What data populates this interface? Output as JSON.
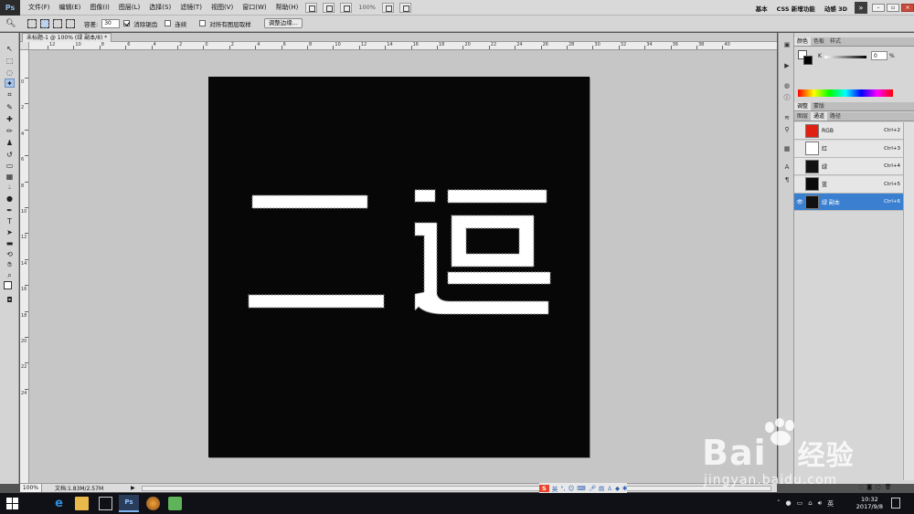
{
  "app": {
    "logo": "Ps",
    "menus": [
      "文件(F)",
      "编辑(E)",
      "图像(I)",
      "图层(L)",
      "选择(S)",
      "滤镜(T)",
      "视图(V)",
      "窗口(W)",
      "帮助(H)"
    ],
    "zoom_value": "100%",
    "workspaces": [
      "基本",
      "CSS 新增功能",
      "动感 3D"
    ],
    "more": "»"
  },
  "options": {
    "tolerance_label": "容差:",
    "tolerance_value": "30",
    "antialias_label": "消除锯齿",
    "contiguous_label": "连续",
    "all_layers_label": "对所有图层取样",
    "refine_edge_label": "调整边缘..."
  },
  "document": {
    "tab_title": "未标题-1 @ 100% (绿 副本/8) *",
    "zoom": "100%",
    "doc_info": "文档:1.83M/2.57M",
    "ruler_h": [
      "12",
      "10",
      "8",
      "6",
      "4",
      "2",
      "0",
      "2",
      "4",
      "6",
      "8",
      "10",
      "12",
      "14",
      "16",
      "18",
      "20",
      "22",
      "24",
      "26",
      "28",
      "30",
      "32",
      "34",
      "36",
      "38",
      "40"
    ],
    "ruler_v": [
      "0",
      "2",
      "4",
      "6",
      "8",
      "10",
      "12",
      "14",
      "16",
      "18",
      "20",
      "22",
      "24"
    ],
    "canvas_text": "二逗"
  },
  "panels": {
    "top_tabs": [
      "颜色",
      "色板",
      "样式"
    ],
    "k_label": "K",
    "k_value": "0",
    "percent": "%",
    "mid_tabs": [
      "调整",
      "蒙版"
    ],
    "bottom_tabs": [
      "图层",
      "通道",
      "路径"
    ],
    "channels": [
      {
        "name": "RGB",
        "shortcut": "Ctrl+2",
        "thumb": "#e02010",
        "selected": false,
        "eye": ""
      },
      {
        "name": "红",
        "shortcut": "Ctrl+3",
        "thumb": "#ffffff",
        "selected": false,
        "eye": ""
      },
      {
        "name": "绿",
        "shortcut": "Ctrl+4",
        "thumb": "#111111",
        "selected": false,
        "eye": ""
      },
      {
        "name": "蓝",
        "shortcut": "Ctrl+5",
        "thumb": "#0a0a0a",
        "selected": false,
        "eye": ""
      },
      {
        "name": "绿 副本",
        "shortcut": "Ctrl+6",
        "thumb": "#111111",
        "selected": true,
        "eye": "👁"
      }
    ]
  },
  "taskbar": {
    "time": "10:32",
    "date": "2017/9/8"
  },
  "ime": {
    "badge": "S",
    "mode": "英"
  },
  "watermark": {
    "brand": "Bai",
    "brand2": "经验",
    "url": "jingyan.baidu.com"
  }
}
